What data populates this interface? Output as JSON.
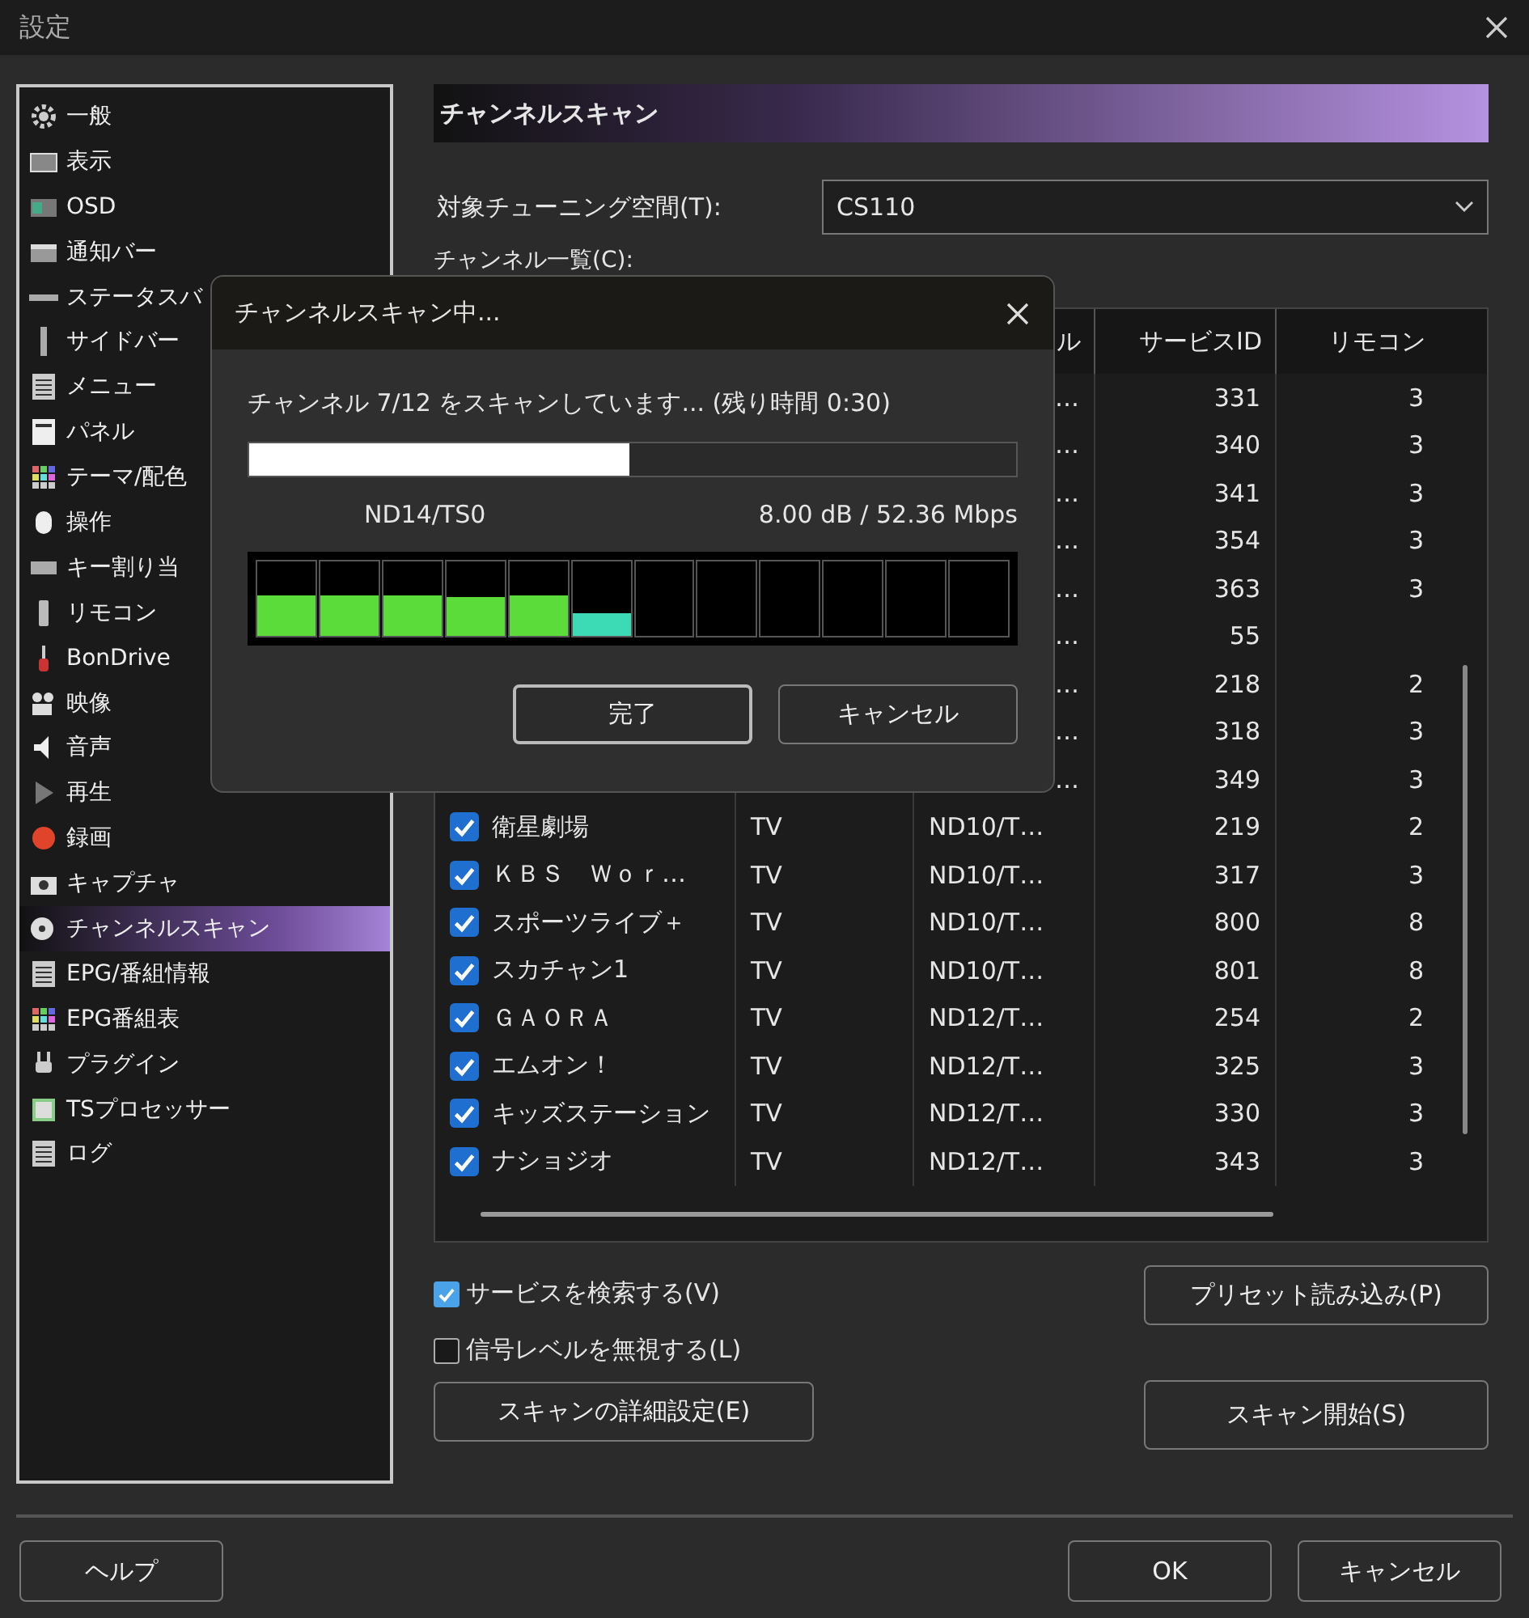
{
  "window": {
    "title": "設定"
  },
  "sidebar": {
    "items": [
      {
        "label": "一般",
        "selected": false
      },
      {
        "label": "表示",
        "selected": false
      },
      {
        "label": "OSD",
        "selected": false
      },
      {
        "label": "通知バー",
        "selected": false
      },
      {
        "label": "ステータスバ",
        "selected": false
      },
      {
        "label": "サイドバー",
        "selected": false
      },
      {
        "label": "メニュー",
        "selected": false
      },
      {
        "label": "パネル",
        "selected": false
      },
      {
        "label": "テーマ/配色",
        "selected": false
      },
      {
        "label": "操作",
        "selected": false
      },
      {
        "label": "キー割り当",
        "selected": false
      },
      {
        "label": "リモコン",
        "selected": false
      },
      {
        "label": "BonDrive",
        "selected": false
      },
      {
        "label": "映像",
        "selected": false
      },
      {
        "label": "音声",
        "selected": false
      },
      {
        "label": "再生",
        "selected": false
      },
      {
        "label": "録画",
        "selected": false
      },
      {
        "label": "キャプチャ",
        "selected": false
      },
      {
        "label": "チャンネルスキャン",
        "selected": true
      },
      {
        "label": "EPG/番組情報",
        "selected": false
      },
      {
        "label": "EPG番組表",
        "selected": false
      },
      {
        "label": "プラグイン",
        "selected": false
      },
      {
        "label": "TSプロセッサー",
        "selected": false
      },
      {
        "label": "ログ",
        "selected": false
      }
    ]
  },
  "panel": {
    "title": "チャンネルスキャン",
    "tuning_label": "対象チューニング空間(T):",
    "tuning_value": "CS110",
    "list_label": "チャンネル一覧(C):",
    "table": {
      "columns": [
        "ル",
        "サービスID",
        "リモコン"
      ],
      "rows": [
        {
          "covered": true,
          "channel": "…",
          "service_id": "331",
          "remote": "3"
        },
        {
          "covered": true,
          "channel": "…",
          "service_id": "340",
          "remote": "3"
        },
        {
          "covered": true,
          "channel": "…",
          "service_id": "341",
          "remote": "3"
        },
        {
          "covered": true,
          "channel": "…",
          "service_id": "354",
          "remote": "3"
        },
        {
          "covered": true,
          "channel": "…",
          "service_id": "363",
          "remote": "3"
        },
        {
          "covered": true,
          "channel": "…",
          "service_id": "55"
        },
        {
          "covered": true,
          "channel": "…",
          "service_id": "218",
          "remote": "2"
        },
        {
          "covered": true,
          "channel": "…",
          "service_id": "318",
          "remote": "3"
        },
        {
          "covered": true,
          "channel": "…",
          "service_id": "349",
          "remote": "3"
        },
        {
          "covered": false,
          "checked": true,
          "name": "衛星劇場",
          "type": "TV",
          "channel": "ND10/T…",
          "service_id": "219",
          "remote": "2"
        },
        {
          "covered": false,
          "checked": true,
          "name": "ＫＢＳ　Ｗｏｒ…",
          "type": "TV",
          "channel": "ND10/T…",
          "service_id": "317",
          "remote": "3"
        },
        {
          "covered": false,
          "checked": true,
          "name": "スポーツライブ＋",
          "type": "TV",
          "channel": "ND10/T…",
          "service_id": "800",
          "remote": "8"
        },
        {
          "covered": false,
          "checked": true,
          "name": "スカチャン1",
          "type": "TV",
          "channel": "ND10/T…",
          "service_id": "801",
          "remote": "8"
        },
        {
          "covered": false,
          "checked": true,
          "name": "ＧＡＯＲＡ",
          "type": "TV",
          "channel": "ND12/T…",
          "service_id": "254",
          "remote": "2"
        },
        {
          "covered": false,
          "checked": true,
          "name": "エムオン！",
          "type": "TV",
          "channel": "ND12/T…",
          "service_id": "325",
          "remote": "3"
        },
        {
          "covered": false,
          "checked": true,
          "name": "キッズステーション",
          "type": "TV",
          "channel": "ND12/T…",
          "service_id": "330",
          "remote": "3"
        },
        {
          "covered": false,
          "checked": true,
          "name": "ナショジオ",
          "type": "TV",
          "channel": "ND12/T…",
          "service_id": "343",
          "remote": "3"
        }
      ]
    },
    "options": [
      {
        "label": "サービスを検索する(V)",
        "checked": true
      },
      {
        "label": "信号レベルを無視する(L)",
        "checked": false
      }
    ],
    "preset_button": "プリセット読み込み(P)",
    "detail_button": "スキャンの詳細設定(E)",
    "start_button": "スキャン開始(S)"
  },
  "footer": {
    "help": "ヘルプ",
    "ok": "OK",
    "cancel": "キャンセル"
  },
  "scan_dialog": {
    "title": "チャンネルスキャン中...",
    "message": "チャンネル 7/12 をスキャンしています... (残り時間 0:30)",
    "progress": {
      "level": 0.495
    },
    "channel": "ND14/TS0",
    "signal": "8.00 dB / 52.36 Mbps",
    "meter": [
      {
        "level": 0.55,
        "color": "#5cdc3a"
      },
      {
        "level": 0.55,
        "color": "#5cdc3a"
      },
      {
        "level": 0.55,
        "color": "#5cdc3a"
      },
      {
        "level": 0.52,
        "color": "#5cdc3a"
      },
      {
        "level": 0.55,
        "color": "#5cdc3a"
      },
      {
        "level": 0.3,
        "color": "#3ddbb5"
      }
    ],
    "buttons": [
      "完了",
      "キャンセル"
    ]
  }
}
